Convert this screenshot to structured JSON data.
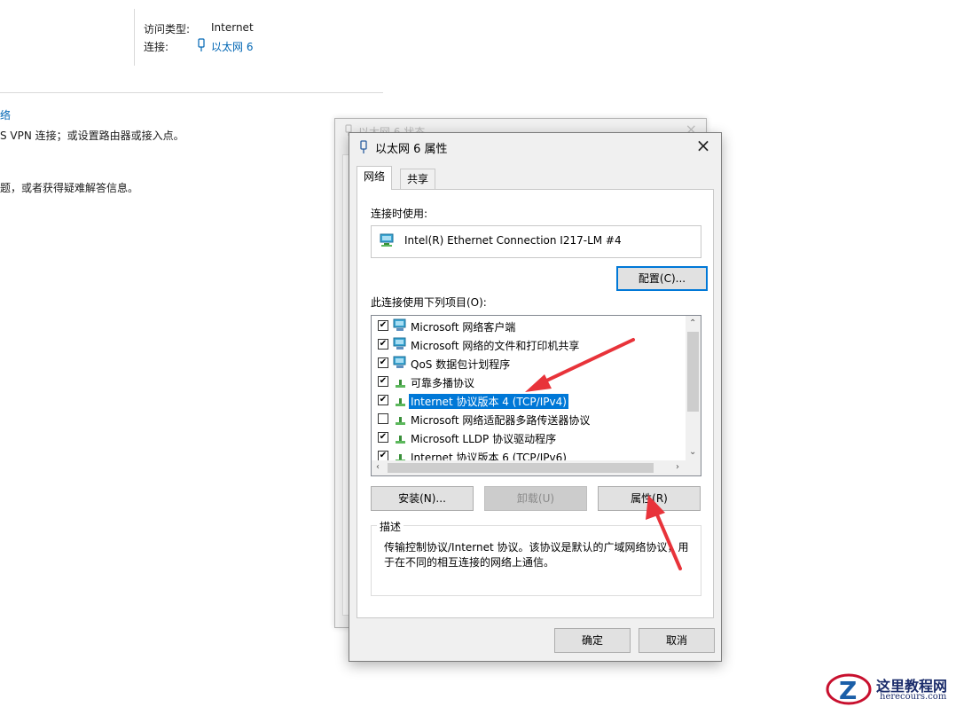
{
  "background": {
    "access_type_label": "访问类型:",
    "access_type_value": "Internet",
    "connection_label": "连接:",
    "connection_value": "以太网 6",
    "left_link_fragment": "络",
    "left_text_1": "S VPN 连接；或设置路由器或接入点。",
    "left_text_2": "题，或者获得疑难解答信息。"
  },
  "status_window": {
    "title": "以太网 6 状态"
  },
  "dialog": {
    "title": "以太网 6 属性",
    "close": "×",
    "tabs": [
      {
        "label": "网络",
        "active": true
      },
      {
        "label": "共享",
        "active": false
      }
    ],
    "connect_using_label": "连接时使用:",
    "adapter_name": "Intel(R) Ethernet Connection I217-LM #4",
    "configure_button": "配置(C)...",
    "items_label": "此连接使用下列项目(O):",
    "items": [
      {
        "label": "Microsoft 网络客户端",
        "checked": true,
        "icon": "network-client-icon"
      },
      {
        "label": "Microsoft 网络的文件和打印机共享",
        "checked": true,
        "icon": "file-share-icon"
      },
      {
        "label": "QoS 数据包计划程序",
        "checked": true,
        "icon": "qos-icon"
      },
      {
        "label": "可靠多播协议",
        "checked": true,
        "icon": "protocol-icon"
      },
      {
        "label": "Internet 协议版本 4 (TCP/IPv4)",
        "checked": true,
        "icon": "protocol-icon",
        "selected": true
      },
      {
        "label": "Microsoft 网络适配器多路传送器协议",
        "checked": false,
        "icon": "protocol-icon"
      },
      {
        "label": "Microsoft LLDP 协议驱动程序",
        "checked": true,
        "icon": "protocol-icon"
      },
      {
        "label": "Internet 协议版本 6 (TCP/IPv6)",
        "checked": true,
        "icon": "protocol-icon"
      }
    ],
    "install_button": "安装(N)...",
    "uninstall_button": "卸载(U)",
    "properties_button": "属性(R)",
    "description_legend": "描述",
    "description_text": "传输控制协议/Internet 协议。该协议是默认的广域网络协议，用于在不同的相互连接的网络上通信。",
    "ok_button": "确定",
    "cancel_button": "取消"
  },
  "watermark": {
    "title": "这里教程网",
    "url": "herecours.com"
  },
  "colors": {
    "accent": "#0078d7",
    "annotation_arrow": "#e8333a",
    "link": "#0066b4"
  }
}
